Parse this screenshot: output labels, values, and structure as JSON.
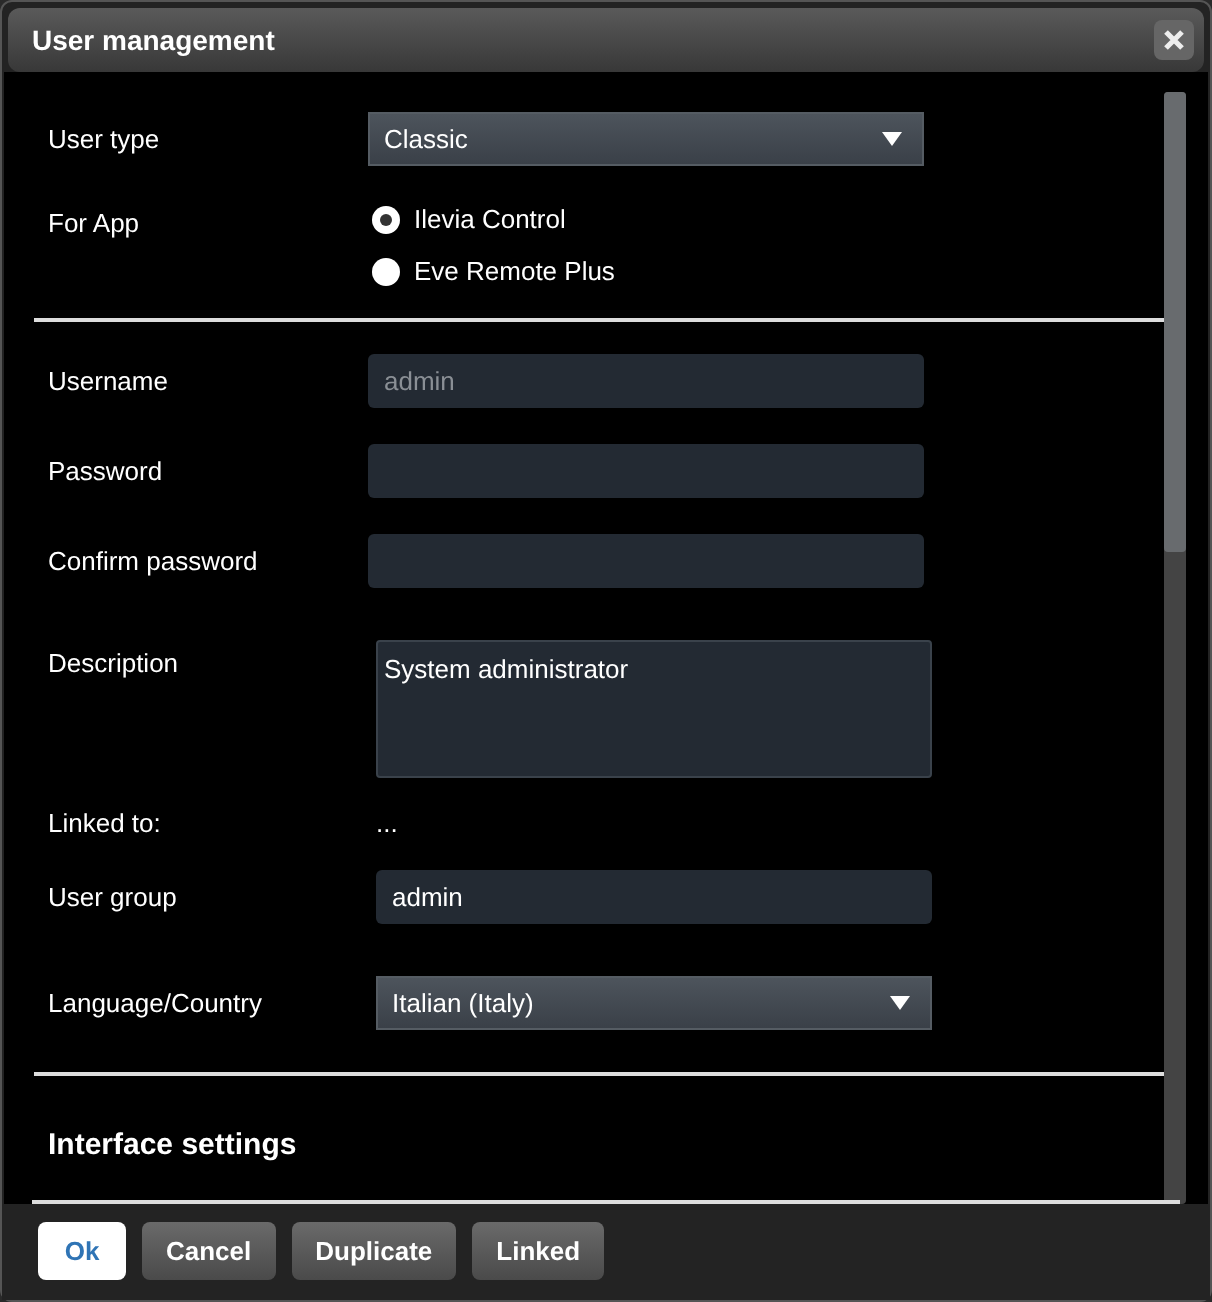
{
  "window": {
    "title": "User management"
  },
  "sections": [
    {
      "rows": [
        {
          "kind": "select",
          "label": "User type",
          "value": "Classic"
        },
        {
          "kind": "radio",
          "label": "For App",
          "options": [
            {
              "label": "Ilevia Control",
              "selected": true
            },
            {
              "label": "Eve Remote Plus",
              "selected": false
            }
          ]
        }
      ]
    },
    {
      "rows": [
        {
          "kind": "text",
          "label": "Username",
          "placeholder": "admin"
        },
        {
          "kind": "text",
          "label": "Password"
        },
        {
          "kind": "text",
          "label": "Confirm password"
        },
        {
          "kind": "textarea",
          "label": "Description",
          "value": "System administrator"
        },
        {
          "kind": "static",
          "label": "Linked to:",
          "value": "..."
        },
        {
          "kind": "text",
          "label": "User group",
          "value": "admin"
        },
        {
          "kind": "select",
          "label": "Language/Country",
          "value": "Italian (Italy)"
        }
      ]
    }
  ],
  "heading": "Interface settings",
  "buttons": [
    {
      "label": "Ok",
      "default": true
    },
    {
      "label": "Cancel",
      "default": false
    },
    {
      "label": "Duplicate",
      "default": false
    },
    {
      "label": "Linked",
      "default": false
    }
  ]
}
